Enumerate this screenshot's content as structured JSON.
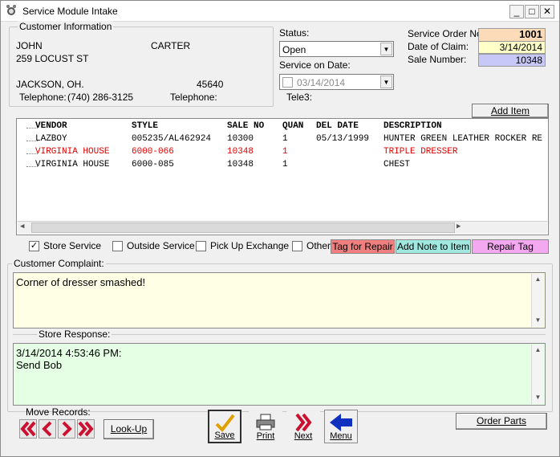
{
  "window": {
    "title": "Service Module Intake",
    "controls": {
      "minimize": "_",
      "maximize": "□",
      "close": "✕"
    }
  },
  "customer": {
    "section_label": "Customer Information",
    "first_name": "JOHN",
    "last_name": "CARTER",
    "address": "259 LOCUST ST",
    "city_state": "JACKSON, OH.",
    "zip": "45640",
    "telephone_label": "Telephone:",
    "telephone": "(740) 286-3125",
    "telephone2_label": "Telephone:",
    "telephone2": "",
    "tele3_label": "Tele3:"
  },
  "status": {
    "label": "Status:",
    "value": "Open",
    "service_date_label": "Service on Date:",
    "service_date": "03/14/2014"
  },
  "order": {
    "service_order_label": "Service Order No:",
    "service_order_no": "1001",
    "date_of_claim_label": "Date of Claim:",
    "date_of_claim": "3/14/2014",
    "sale_number_label": "Sale Number:",
    "sale_number": "10348"
  },
  "add_item_label": "Add Item",
  "items_table": {
    "headers": [
      "VENDOR",
      "STYLE",
      "SALE NO",
      "QUAN",
      "DEL DATE",
      "DESCRIPTION"
    ],
    "rows": [
      {
        "vendor": "LAZBOY",
        "style": "005235/AL462924",
        "sale_no": "10300",
        "quan": "1",
        "del_date": "05/13/1999",
        "description": "HUNTER GREEN LEATHER ROCKER RE",
        "highlight": false
      },
      {
        "vendor": "VIRGINIA HOUSE",
        "style": "6000-066",
        "sale_no": "10348",
        "quan": "1",
        "del_date": "",
        "description": "TRIPLE DRESSER",
        "highlight": true
      },
      {
        "vendor": "VIRGINIA HOUSE",
        "style": "6000-085",
        "sale_no": "10348",
        "quan": "1",
        "del_date": "",
        "description": "CHEST",
        "highlight": false
      }
    ]
  },
  "options": {
    "store_service": {
      "label": "Store Service",
      "checked": true
    },
    "outside_service": {
      "label": "Outside Service",
      "checked": false
    },
    "pickup_exchange": {
      "label": "Pick Up  Exchange",
      "checked": false
    },
    "other": {
      "label": "Other",
      "checked": false
    }
  },
  "tag_buttons": {
    "tag_for_repair": "Tag for Repair",
    "add_note": "Add Note to Item",
    "repair_tag": "Repair Tag"
  },
  "colors": {
    "tag_for_repair_bg": "#f08080",
    "add_note_bg": "#a0e8e0",
    "repair_tag_bg": "#f4a8f0",
    "complaint_bg": "#ffffe6",
    "response_bg": "#e4ffe4",
    "service_order_bg": "#fcdcb8",
    "date_claim_bg": "#ffffc8",
    "sale_number_bg": "#c8c8f8",
    "highlight_row": "#e00000"
  },
  "complaint": {
    "label": "Customer Complaint:",
    "text": "Corner of dresser smashed!"
  },
  "response": {
    "label": "Store Response:",
    "line1": "3/14/2014 4:53:46 PM:",
    "line2": "Send Bob"
  },
  "footer": {
    "move_records_label": "Move Records:",
    "lookup_label": "Look-Up",
    "save_label": "Save",
    "print_label": "Print",
    "next_label": "Next",
    "menu_label": "Menu",
    "order_parts_label": "Order Parts"
  }
}
